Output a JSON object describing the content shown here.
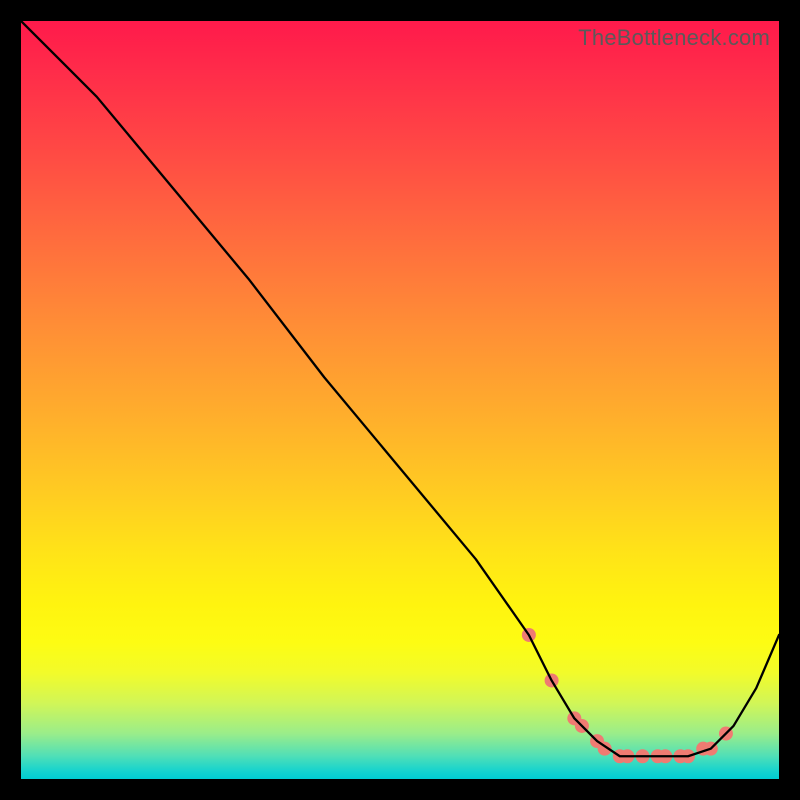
{
  "watermark": "TheBottleneck.com",
  "chart_data": {
    "type": "line",
    "title": "",
    "xlabel": "",
    "ylabel": "",
    "xlim": [
      0,
      100
    ],
    "ylim": [
      0,
      100
    ],
    "series": [
      {
        "name": "bottleneck-curve",
        "x": [
          0,
          6,
          10,
          20,
          30,
          40,
          50,
          60,
          67,
          70,
          73,
          76,
          79,
          82,
          85,
          88,
          91,
          94,
          97,
          100
        ],
        "values": [
          100,
          94,
          90,
          78,
          66,
          53,
          41,
          29,
          19,
          13,
          8,
          5,
          3,
          3,
          3,
          3,
          4,
          7,
          12,
          19
        ]
      }
    ],
    "markers": {
      "name": "highlight-range",
      "x": [
        67,
        70,
        73,
        74,
        76,
        77,
        79,
        80,
        82,
        84,
        85,
        87,
        88,
        90,
        91,
        93
      ],
      "values": [
        19,
        13,
        8,
        7,
        5,
        4,
        3,
        3,
        3,
        3,
        3,
        3,
        3,
        4,
        4,
        6
      ],
      "color": "#ef7b72",
      "radius_px": 7
    }
  }
}
